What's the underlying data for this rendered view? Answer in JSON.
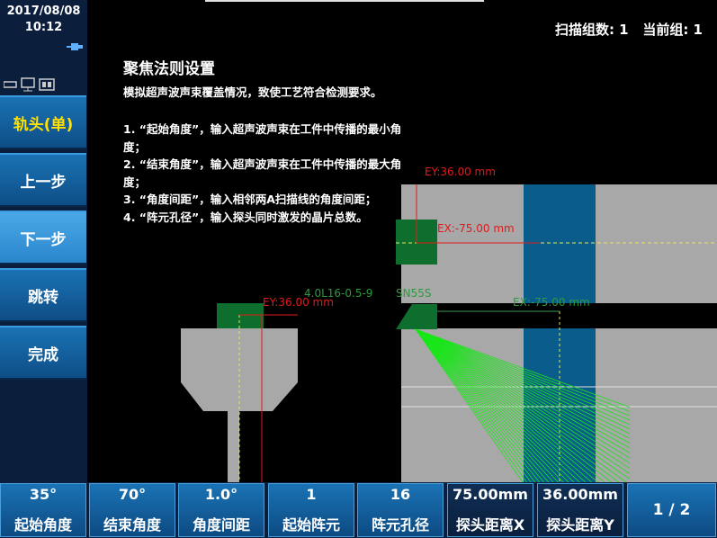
{
  "status": {
    "date": "2017/08/08",
    "time": "10:12"
  },
  "header": {
    "scan_groups": "扫描组数: 1",
    "current_group": "当前组: 1"
  },
  "sidebar": {
    "items": [
      {
        "label": "轨头(单)"
      },
      {
        "label": "上一步"
      },
      {
        "label": "下一步"
      },
      {
        "label": "跳转"
      },
      {
        "label": "完成"
      }
    ]
  },
  "content": {
    "title": "聚焦法则设置",
    "subtitle": "模拟超声波声束覆盖情况，致使工艺符合检测要求。",
    "instructions": [
      "1. “起始角度”，输入超声波声束在工件中传播的最小角度；",
      "2. “结束角度”，输入超声波声束在工件中传播的最大角度；",
      "3. “角度间距”，输入相邻两A扫描线的角度间距；",
      "4. “阵元孔径”，输入探头同时激发的晶片总数。"
    ]
  },
  "scene": {
    "ey_top": "EY:36.00 mm",
    "ex_right": "EX:-75.00 mm",
    "probe_label": "4.0L16-0.5-9",
    "wedge_label": "SN55S",
    "ey_left": "EY:36.00 mm",
    "ex_green": "EX:-75.00 mm",
    "colors": {
      "part": "#a8a8a8",
      "weld": "#0a5d8a",
      "probe": "#0d6e2e",
      "beam": "#19e619",
      "ey": "#e21a1a"
    }
  },
  "params": [
    {
      "value": "35°",
      "name": "起始角度"
    },
    {
      "value": "70°",
      "name": "结束角度"
    },
    {
      "value": "1.0°",
      "name": "角度间距"
    },
    {
      "value": "1",
      "name": "起始阵元"
    },
    {
      "value": "16",
      "name": "阵元孔径"
    },
    {
      "value": "75.00mm",
      "name": "探头距离X"
    },
    {
      "value": "36.00mm",
      "name": "探头距离Y"
    }
  ],
  "page": "1 / 2"
}
